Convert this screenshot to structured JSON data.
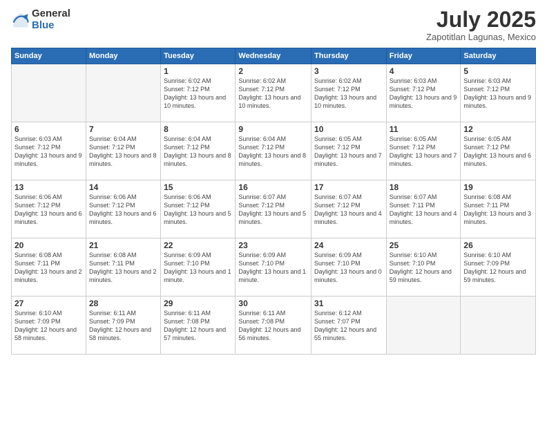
{
  "header": {
    "logo_general": "General",
    "logo_blue": "Blue",
    "month_title": "July 2025",
    "subtitle": "Zapotitlan Lagunas, Mexico"
  },
  "weekdays": [
    "Sunday",
    "Monday",
    "Tuesday",
    "Wednesday",
    "Thursday",
    "Friday",
    "Saturday"
  ],
  "weeks": [
    [
      {
        "day": "",
        "info": ""
      },
      {
        "day": "",
        "info": ""
      },
      {
        "day": "1",
        "info": "Sunrise: 6:02 AM\nSunset: 7:12 PM\nDaylight: 13 hours and 10 minutes."
      },
      {
        "day": "2",
        "info": "Sunrise: 6:02 AM\nSunset: 7:12 PM\nDaylight: 13 hours and 10 minutes."
      },
      {
        "day": "3",
        "info": "Sunrise: 6:02 AM\nSunset: 7:12 PM\nDaylight: 13 hours and 10 minutes."
      },
      {
        "day": "4",
        "info": "Sunrise: 6:03 AM\nSunset: 7:12 PM\nDaylight: 13 hours and 9 minutes."
      },
      {
        "day": "5",
        "info": "Sunrise: 6:03 AM\nSunset: 7:12 PM\nDaylight: 13 hours and 9 minutes."
      }
    ],
    [
      {
        "day": "6",
        "info": "Sunrise: 6:03 AM\nSunset: 7:12 PM\nDaylight: 13 hours and 9 minutes."
      },
      {
        "day": "7",
        "info": "Sunrise: 6:04 AM\nSunset: 7:12 PM\nDaylight: 13 hours and 8 minutes."
      },
      {
        "day": "8",
        "info": "Sunrise: 6:04 AM\nSunset: 7:12 PM\nDaylight: 13 hours and 8 minutes."
      },
      {
        "day": "9",
        "info": "Sunrise: 6:04 AM\nSunset: 7:12 PM\nDaylight: 13 hours and 8 minutes."
      },
      {
        "day": "10",
        "info": "Sunrise: 6:05 AM\nSunset: 7:12 PM\nDaylight: 13 hours and 7 minutes."
      },
      {
        "day": "11",
        "info": "Sunrise: 6:05 AM\nSunset: 7:12 PM\nDaylight: 13 hours and 7 minutes."
      },
      {
        "day": "12",
        "info": "Sunrise: 6:05 AM\nSunset: 7:12 PM\nDaylight: 13 hours and 6 minutes."
      }
    ],
    [
      {
        "day": "13",
        "info": "Sunrise: 6:06 AM\nSunset: 7:12 PM\nDaylight: 13 hours and 6 minutes."
      },
      {
        "day": "14",
        "info": "Sunrise: 6:06 AM\nSunset: 7:12 PM\nDaylight: 13 hours and 6 minutes."
      },
      {
        "day": "15",
        "info": "Sunrise: 6:06 AM\nSunset: 7:12 PM\nDaylight: 13 hours and 5 minutes."
      },
      {
        "day": "16",
        "info": "Sunrise: 6:07 AM\nSunset: 7:12 PM\nDaylight: 13 hours and 5 minutes."
      },
      {
        "day": "17",
        "info": "Sunrise: 6:07 AM\nSunset: 7:12 PM\nDaylight: 13 hours and 4 minutes."
      },
      {
        "day": "18",
        "info": "Sunrise: 6:07 AM\nSunset: 7:11 PM\nDaylight: 13 hours and 4 minutes."
      },
      {
        "day": "19",
        "info": "Sunrise: 6:08 AM\nSunset: 7:11 PM\nDaylight: 13 hours and 3 minutes."
      }
    ],
    [
      {
        "day": "20",
        "info": "Sunrise: 6:08 AM\nSunset: 7:11 PM\nDaylight: 13 hours and 2 minutes."
      },
      {
        "day": "21",
        "info": "Sunrise: 6:08 AM\nSunset: 7:11 PM\nDaylight: 13 hours and 2 minutes."
      },
      {
        "day": "22",
        "info": "Sunrise: 6:09 AM\nSunset: 7:10 PM\nDaylight: 13 hours and 1 minute."
      },
      {
        "day": "23",
        "info": "Sunrise: 6:09 AM\nSunset: 7:10 PM\nDaylight: 13 hours and 1 minute."
      },
      {
        "day": "24",
        "info": "Sunrise: 6:09 AM\nSunset: 7:10 PM\nDaylight: 13 hours and 0 minutes."
      },
      {
        "day": "25",
        "info": "Sunrise: 6:10 AM\nSunset: 7:10 PM\nDaylight: 12 hours and 59 minutes."
      },
      {
        "day": "26",
        "info": "Sunrise: 6:10 AM\nSunset: 7:09 PM\nDaylight: 12 hours and 59 minutes."
      }
    ],
    [
      {
        "day": "27",
        "info": "Sunrise: 6:10 AM\nSunset: 7:09 PM\nDaylight: 12 hours and 58 minutes."
      },
      {
        "day": "28",
        "info": "Sunrise: 6:11 AM\nSunset: 7:09 PM\nDaylight: 12 hours and 58 minutes."
      },
      {
        "day": "29",
        "info": "Sunrise: 6:11 AM\nSunset: 7:08 PM\nDaylight: 12 hours and 57 minutes."
      },
      {
        "day": "30",
        "info": "Sunrise: 6:11 AM\nSunset: 7:08 PM\nDaylight: 12 hours and 56 minutes."
      },
      {
        "day": "31",
        "info": "Sunrise: 6:12 AM\nSunset: 7:07 PM\nDaylight: 12 hours and 55 minutes."
      },
      {
        "day": "",
        "info": ""
      },
      {
        "day": "",
        "info": ""
      }
    ]
  ]
}
